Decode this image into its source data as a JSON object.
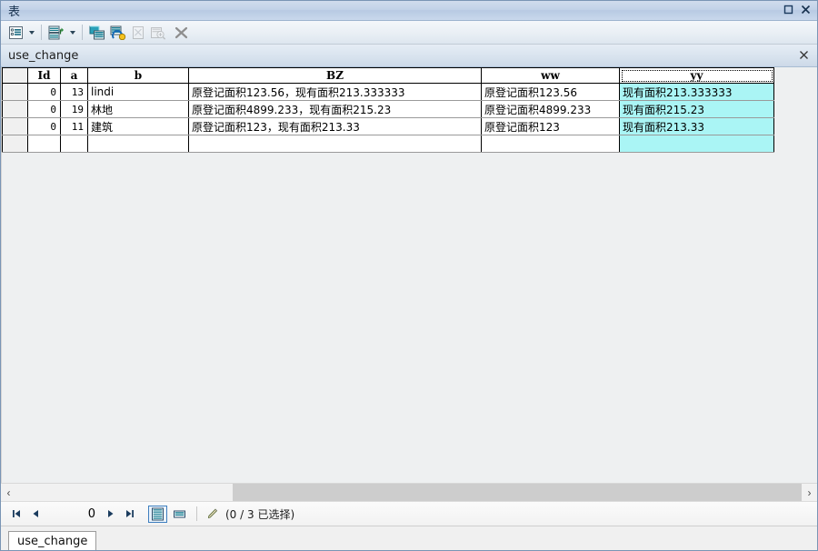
{
  "window": {
    "title": "表",
    "maximize_icon": "maximize-icon",
    "close_icon": "close-icon"
  },
  "toolbar": {
    "items": [
      {
        "name": "table-options-button",
        "icon": "table-options-icon",
        "has_dropdown": true,
        "enabled": true
      },
      {
        "name": "related-tables-button",
        "icon": "related-tables-icon",
        "has_dropdown": true,
        "enabled": true
      },
      {
        "name": "add-table-button",
        "icon": "add-table-icon",
        "has_dropdown": false,
        "enabled": true
      },
      {
        "name": "refresh-table-button",
        "icon": "refresh-table-icon",
        "has_dropdown": false,
        "enabled": true
      },
      {
        "name": "clear-selection-button",
        "icon": "clear-selection-icon",
        "has_dropdown": false,
        "enabled": false
      },
      {
        "name": "zoom-to-selection-button",
        "icon": "zoom-to-selection-icon",
        "has_dropdown": false,
        "enabled": false
      },
      {
        "name": "delete-button",
        "icon": "delete-x-icon",
        "has_dropdown": false,
        "enabled": false
      }
    ]
  },
  "panel": {
    "title": "use_change",
    "close_label": "×"
  },
  "grid": {
    "columns": [
      {
        "key": "id",
        "label": "Id",
        "selected": false
      },
      {
        "key": "a",
        "label": "a",
        "selected": false
      },
      {
        "key": "b",
        "label": "b",
        "selected": false
      },
      {
        "key": "bz",
        "label": "BZ",
        "selected": false
      },
      {
        "key": "ww",
        "label": "ww",
        "selected": false
      },
      {
        "key": "yy",
        "label": "yy",
        "selected": true
      }
    ],
    "highlight_color": "#aaf5f5",
    "rows": [
      {
        "id": "0",
        "a": "13",
        "b": "lindi",
        "bz": "原登记面积123.56，现有面积213.333333",
        "ww": "原登记面积123.56",
        "yy": "现有面积213.333333"
      },
      {
        "id": "0",
        "a": "19",
        "b": "林地",
        "bz": "原登记面积4899.233，现有面积215.23",
        "ww": "原登记面积4899.233",
        "yy": "现有面积215.23"
      },
      {
        "id": "0",
        "a": "11",
        "b": "建筑",
        "bz": "原登记面积123，现有面积213.33",
        "ww": "原登记面积123",
        "yy": "现有面积213.33"
      }
    ],
    "blank_row": {
      "id": "",
      "a": "",
      "b": "",
      "bz": "",
      "ww": "",
      "yy": ""
    }
  },
  "scrollbar": {
    "left_arrow": "‹",
    "right_arrow": "›"
  },
  "statusbar": {
    "first_icon": "first-record-icon",
    "prev_icon": "previous-record-icon",
    "record_number": "0",
    "next_icon": "next-record-icon",
    "last_icon": "last-record-icon",
    "table_view_icon": "table-view-icon",
    "selected_view_icon": "selected-records-view-icon",
    "edit_icon": "edit-pencil-icon",
    "selection_text": "(0 / 3 已选择)"
  },
  "tabs": [
    {
      "label": "use_change",
      "active": true
    }
  ]
}
